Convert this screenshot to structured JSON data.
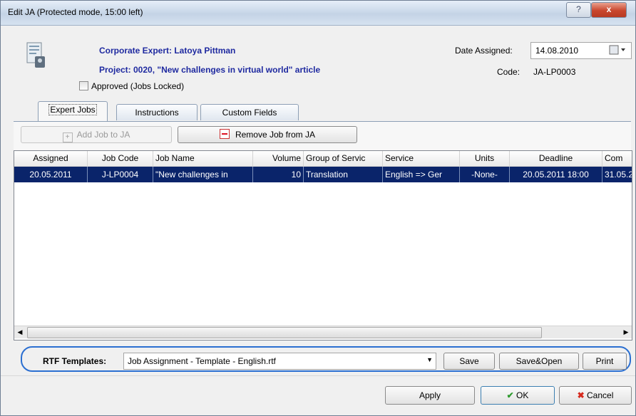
{
  "window": {
    "title": "Edit JA (Protected mode, 15:00 left)"
  },
  "titlebar": {
    "help_glyph": "?",
    "close_glyph": "x"
  },
  "header": {
    "expert": "Corporate Expert: Latoya Pittman",
    "project": "Project: 0020, \"New challenges in virtual world\" article",
    "approved_label": "Approved (Jobs Locked)",
    "approved_checked": false,
    "date_label": "Date Assigned:",
    "date_value": "14.08.2010",
    "code_label": "Code:",
    "code_value": "JA-LP0003"
  },
  "tabs": [
    {
      "label": "Expert Jobs",
      "active": true
    },
    {
      "label": "Instructions",
      "active": false
    },
    {
      "label": "Custom Fields",
      "active": false
    }
  ],
  "toolbar": {
    "add_label": "Add Job to JA",
    "add_enabled": false,
    "remove_label": "Remove Job from JA"
  },
  "grid": {
    "columns": [
      "Assigned",
      "Job Code",
      "Job Name",
      "Volume",
      "Group of Servic",
      "Service",
      "Units",
      "Deadline",
      "Com"
    ],
    "rows": [
      [
        "20.05.2011",
        "J-LP0004",
        "\"New challenges in",
        "10",
        "Translation",
        "English => Ger",
        "-None-",
        "20.05.2011 18:00",
        "31.05.2"
      ]
    ],
    "selected_row": 0
  },
  "rtf": {
    "label": "RTF Templates:",
    "selected": "Job Assignment - Template - English.rtf",
    "save_label": "Save",
    "save_open_label": "Save&Open",
    "print_label": "Print"
  },
  "footer": {
    "apply_label": "Apply",
    "ok_label": "OK",
    "cancel_label": "Cancel"
  },
  "colors": {
    "selection_bg": "#0a246a",
    "header_text": "#1f2aa0",
    "highlight_outline": "#2b6fd1",
    "close_button": "#c8462d"
  }
}
